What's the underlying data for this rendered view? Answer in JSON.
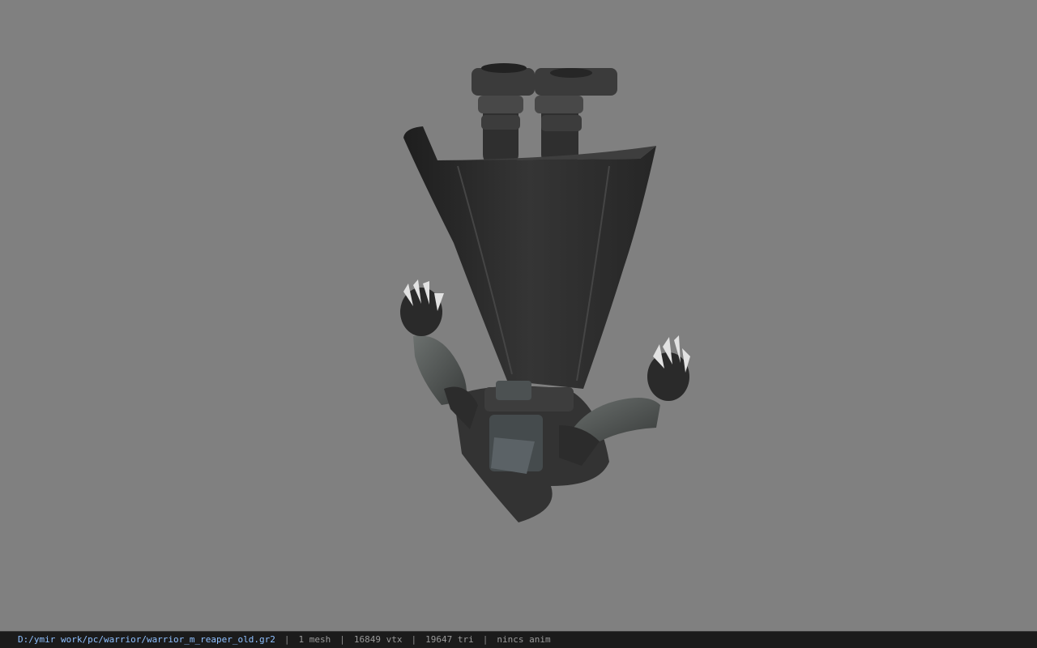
{
  "viewer": {
    "model": "warrior_m_reaper_old.gr2"
  },
  "statusbar": {
    "file_path": "D:/ymir work/pc/warrior/warrior_m_reaper_old.gr2",
    "separator": "|",
    "mesh_count": "1 mesh",
    "vertex_count": "16849 vtx",
    "triangle_count": "19647 tri",
    "animation": "nincs anim"
  },
  "colors": {
    "background": "#808080",
    "statusbar_bg": "#1b1b1b",
    "path_text": "#8fc0ff",
    "info_text": "#9a9a9a"
  }
}
